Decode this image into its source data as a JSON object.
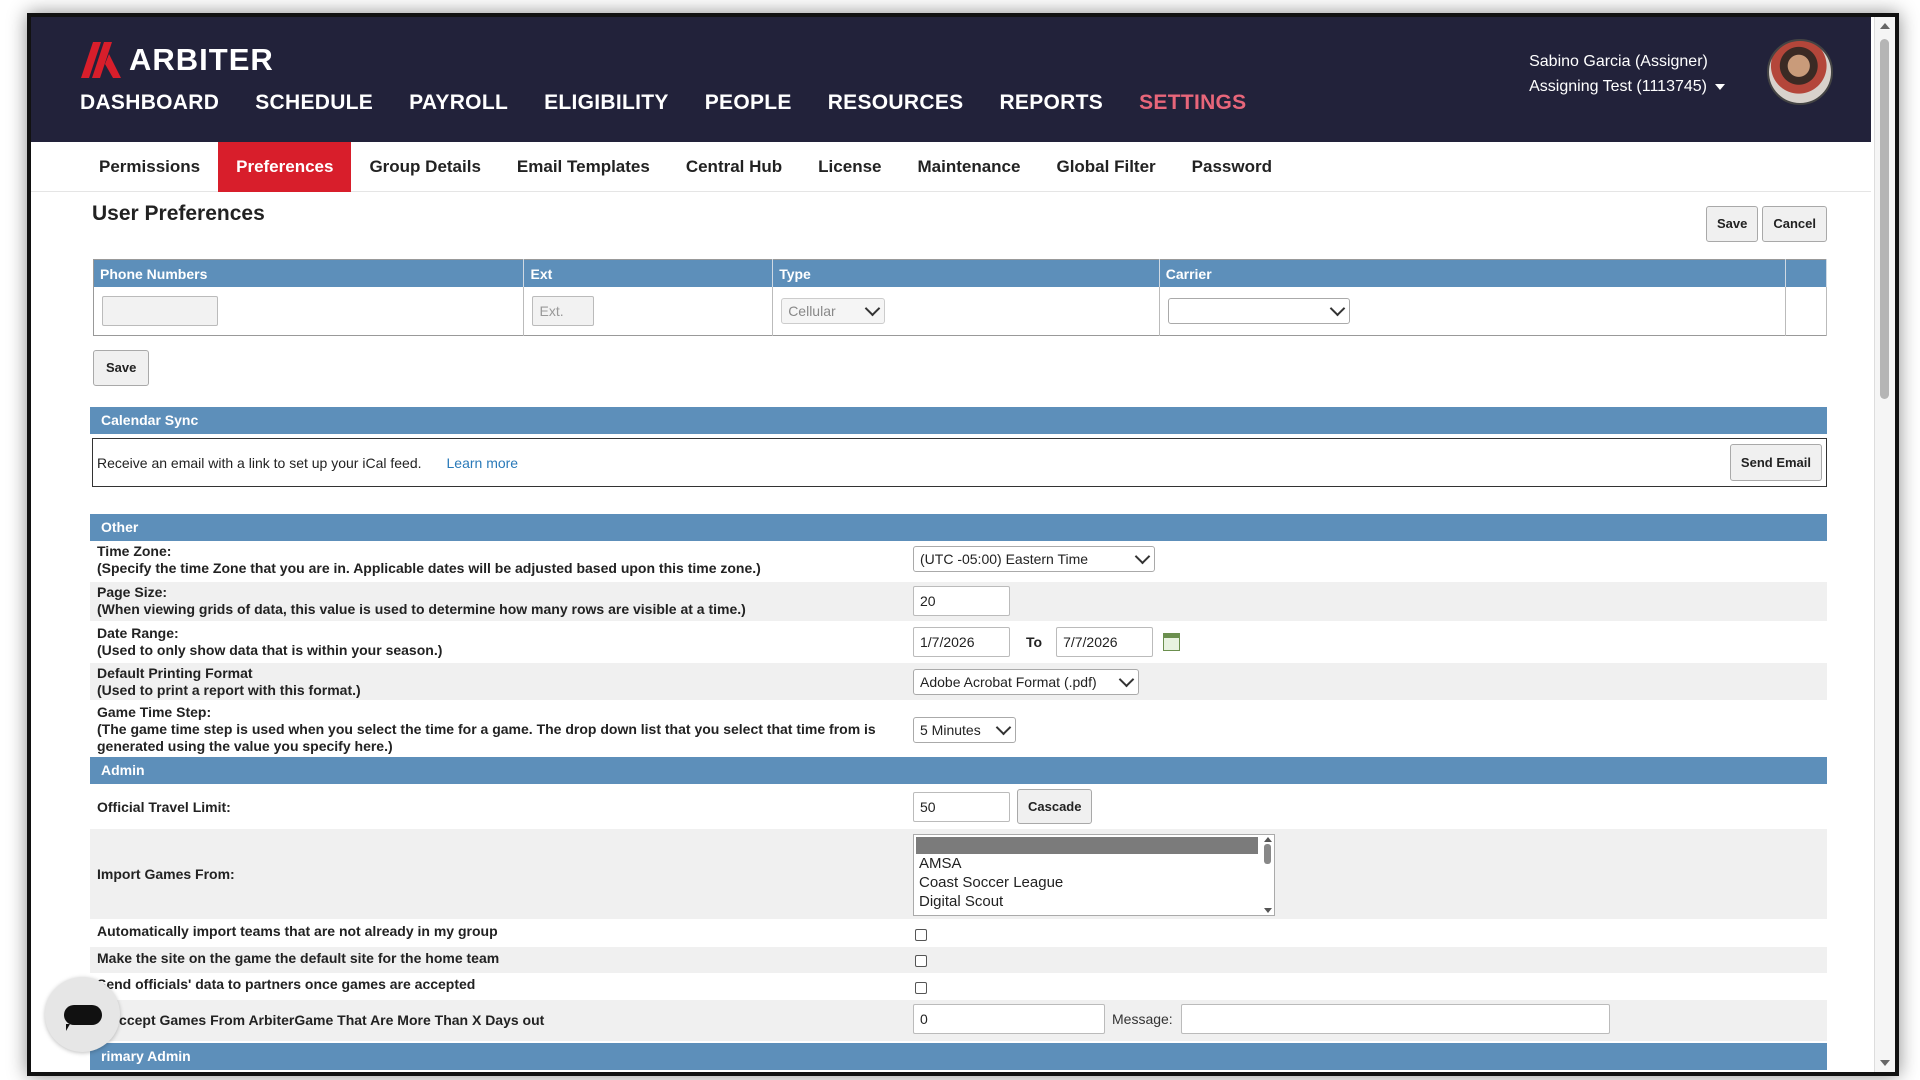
{
  "brand": {
    "name": "ARBITER",
    "accent": "#d81e2b",
    "nav_bg": "#22223a",
    "section_blue": "#5d8fba"
  },
  "main_nav": [
    {
      "label": "DASHBOARD"
    },
    {
      "label": "SCHEDULE"
    },
    {
      "label": "PAYROLL"
    },
    {
      "label": "ELIGIBILITY"
    },
    {
      "label": "PEOPLE"
    },
    {
      "label": "RESOURCES"
    },
    {
      "label": "REPORTS"
    },
    {
      "label": "SETTINGS",
      "active": true
    }
  ],
  "user": {
    "name": "Sabino Garcia (Assigner)",
    "group": "Assigning Test (1113745)"
  },
  "sub_nav": [
    {
      "label": "Permissions"
    },
    {
      "label": "Preferences",
      "active": true
    },
    {
      "label": "Group Details"
    },
    {
      "label": "Email Templates"
    },
    {
      "label": "Central Hub"
    },
    {
      "label": "License"
    },
    {
      "label": "Maintenance"
    },
    {
      "label": "Global Filter"
    },
    {
      "label": "Password"
    }
  ],
  "page": {
    "title": "User Preferences",
    "save_label": "Save",
    "cancel_label": "Cancel"
  },
  "phone_table": {
    "headers": [
      "Phone Numbers",
      "Ext",
      "Type",
      "Carrier"
    ],
    "ext_placeholder": "Ext.",
    "type_value": "Cellular",
    "carrier_value": "",
    "save_label": "Save"
  },
  "calendar_sync": {
    "title": "Calendar Sync",
    "text": "Receive an email with a link to set up your iCal feed.",
    "link": "Learn more",
    "button": "Send Email"
  },
  "other": {
    "title": "Other",
    "time_zone": {
      "label": "Time Zone:",
      "help": "(Specify the time Zone that you are in. Applicable dates will be adjusted based upon this time zone.)",
      "value": "(UTC -05:00) Eastern Time"
    },
    "page_size": {
      "label": "Page Size:",
      "help": "(When viewing grids of data, this value is used to determine how many rows are visible at a time.)",
      "value": "20"
    },
    "date_range": {
      "label": "Date Range:",
      "help": "(Used to only show data that is within your season.)",
      "from": "1/7/2026",
      "to_label": "To",
      "to": "7/7/2026"
    },
    "printing_format": {
      "label": "Default Printing Format",
      "help": "(Used to print a report with this format.)",
      "value": "Adobe Acrobat Format (.pdf)"
    },
    "game_time_step": {
      "label": "Game Time Step:",
      "help": "(The game time step is used when you select the time for a game. The drop down list that you select that time from is generated using the value you specify here.)",
      "value": "5 Minutes"
    }
  },
  "admin": {
    "title": "Admin",
    "travel_limit": {
      "label": "Official Travel Limit:",
      "value": "50",
      "button": "Cascade"
    },
    "import_games": {
      "label": "Import Games From:",
      "options": [
        "AMSA",
        "Coast Soccer League",
        "Digital Scout"
      ]
    },
    "auto_import_teams": {
      "label": "Automatically import teams that are not already in my group",
      "checked": false
    },
    "default_site": {
      "label": "Make the site on the game the default site for the home team",
      "checked": false
    },
    "send_officials": {
      "label": "Send officials' data to partners once games are accepted",
      "checked": false
    },
    "auto_accept": {
      "label": "o Accept Games From ArbiterGame That Are More Than X Days out",
      "value": "0",
      "message_label": "Message:",
      "message_value": ""
    }
  },
  "primary_admin": {
    "title": "rimary Admin"
  }
}
